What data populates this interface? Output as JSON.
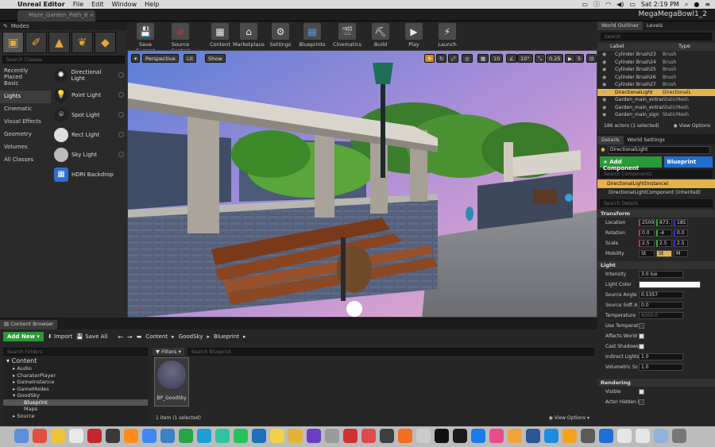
{
  "menubar": {
    "app": "Unreal Editor",
    "items": [
      "File",
      "Edit",
      "Window",
      "Help"
    ],
    "clock": "Sat 2:19 PM"
  },
  "titlebar": {
    "doc_tab": "Maze_Garden_Path_8",
    "project": "MegaMegaBowl1_2"
  },
  "modes": {
    "title": "Modes",
    "search_placeholder": "Search Classes",
    "categories": [
      "Recently Placed",
      "Basic",
      "Lights",
      "Cinematic",
      "Visual Effects",
      "Geometry",
      "Volumes",
      "All Classes"
    ],
    "selected_category": "Lights",
    "items": [
      "Directional Light",
      "Point Light",
      "Spot Light",
      "Rect Light",
      "Sky Light",
      "HDRI Backdrop"
    ]
  },
  "toolbar": {
    "buttons": [
      "Save Current",
      "Source Control",
      "Content",
      "Marketplace",
      "Settings",
      "Blueprints",
      "Cinematics",
      "Build",
      "Play",
      "Launch"
    ]
  },
  "viewport": {
    "perspective": "Perspective",
    "lit": "Lit",
    "show": "Show",
    "grid_snap": "10",
    "rot_snap": "10°",
    "scale_snap": "0.25",
    "cam_speed": "5"
  },
  "outliner": {
    "tabs": [
      "World Outliner",
      "Levels"
    ],
    "search_placeholder": "Search",
    "col_label": "Label",
    "col_type": "Type",
    "rows": [
      {
        "label": "Cylinder Brush23",
        "type": "Brush"
      },
      {
        "label": "Cylinder Brush24",
        "type": "Brush"
      },
      {
        "label": "Cylinder Brush25",
        "type": "Brush"
      },
      {
        "label": "Cylinder Brush26",
        "type": "Brush"
      },
      {
        "label": "Cylinder Brush27",
        "type": "Brush"
      },
      {
        "label": "DirectionalLight",
        "type": "DirectionalL"
      },
      {
        "label": "Garden_main_entran",
        "type": "StaticMesh"
      },
      {
        "label": "Garden_main_entran",
        "type": "StaticMesh"
      },
      {
        "label": "Garden_main_sign",
        "type": "StaticMesh"
      }
    ],
    "status": "186 actors (1 selected)",
    "view_options": "View Options"
  },
  "details": {
    "tabs": [
      "Details",
      "World Settings"
    ],
    "name": "DirectionalLight",
    "add_component": "+ Add Component",
    "blueprint": "Blueprint",
    "search_components": "Search Components",
    "instance": "DirectionalLight(Instance)",
    "component": "DirectionalLightComponent (Inherited)",
    "search_details": "Search Details",
    "transform_title": "Transform",
    "location_label": "Location",
    "location": [
      "2500",
      "873.",
      "185"
    ],
    "rotation_label": "Rotation",
    "rotation": [
      "0.0",
      "-4",
      "0.0"
    ],
    "scale_label": "Scale",
    "scale": [
      "2.5",
      "2.5",
      "2.5"
    ],
    "mobility_label": "Mobility",
    "mobility": [
      "St",
      "St",
      "M"
    ],
    "light_title": "Light",
    "intensity_label": "Intensity",
    "intensity": "3.0 lux",
    "light_color_label": "Light Color",
    "source_angle_label": "Source Angle",
    "source_angle": "0.5357",
    "source_soft_label": "Source Soft A",
    "source_soft": "0.0",
    "temperature_label": "Temperature",
    "temperature": "6500.0",
    "use_temp_label": "Use Temperat",
    "affects_world_label": "Affects World",
    "cast_shadows_label": "Cast Shadows",
    "indirect_label": "Indirect Lights",
    "indirect": "1.0",
    "volumetric_label": "Volumetric Sc",
    "volumetric": "1.0",
    "rendering_title": "Rendering",
    "visible_label": "Visible",
    "hidden_label": "Actor Hidden I"
  },
  "content_browser": {
    "title": "Content Browser",
    "add_new": "Add New",
    "import": "Import",
    "save_all": "Save All",
    "breadcrumb": [
      "Content",
      "GoodSky",
      "Blueprint"
    ],
    "search_folders": "Search Folders",
    "filters": "Filters",
    "search_assets": "Search Blueprint",
    "tree": [
      {
        "label": "Content",
        "level": 0
      },
      {
        "label": "Audio",
        "level": 1
      },
      {
        "label": "CharaterPlayer",
        "level": 1
      },
      {
        "label": "GameInstance",
        "level": 1
      },
      {
        "label": "GameModes",
        "level": 1
      },
      {
        "label": "GoodSky",
        "level": 1
      },
      {
        "label": "Blueprint",
        "level": 2
      },
      {
        "label": "Maps",
        "level": 2
      },
      {
        "label": "Source",
        "level": 1
      }
    ],
    "asset": "BP_GoodSky",
    "status": "1 item (1 selected)",
    "view_options": "View Options"
  },
  "dock": {
    "colors": [
      "#5b8fd9",
      "#e34f3c",
      "#f0c13a",
      "#e8e8e8",
      "#c1272d",
      "#3a3a3a",
      "#ff8c1a",
      "#4285f4",
      "#3b82c4",
      "#27a348",
      "#1e9fd6",
      "#2ec4a0",
      "#25c456",
      "#1d6fb8",
      "#f2d14b",
      "#e4b234",
      "#6a3cc4",
      "#9b9b9b",
      "#d03030",
      "#e04a4a",
      "#3f3f3f",
      "#f36f21",
      "#cccccc",
      "#111111",
      "#1c1c1c",
      "#1a7de8",
      "#ea4c89",
      "#f2a33a",
      "#2b5797",
      "#1b8de0",
      "#f7a21b",
      "#5a5a5a",
      "#1e6fd9",
      "#e6e6e6",
      "#e6e6e6",
      "#8fb3d9",
      "#777777"
    ]
  }
}
